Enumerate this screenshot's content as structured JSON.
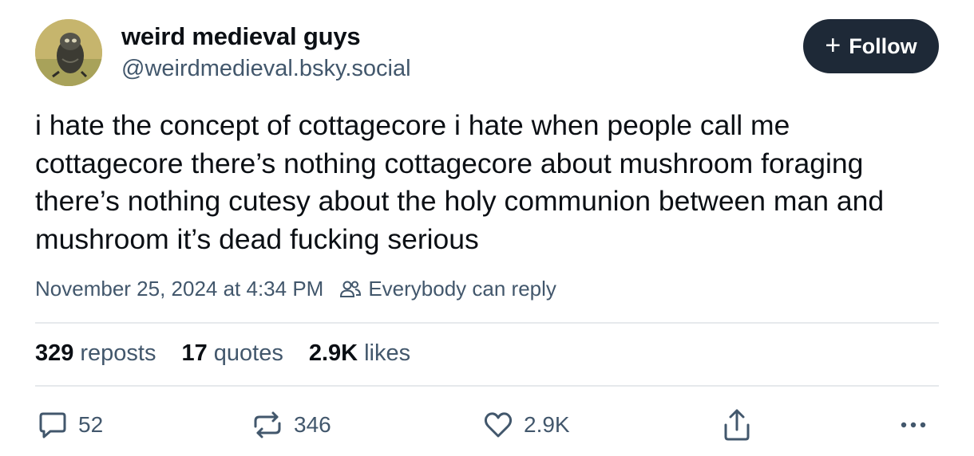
{
  "author": {
    "display_name": "weird medieval guys",
    "handle": "@weirdmedieval.bsky.social"
  },
  "follow_button": {
    "label": "Follow"
  },
  "post": {
    "text": "i hate the concept of cottagecore i hate when people call me cottagecore there’s nothing cottagecore about mushroom foraging there’s nothing cutesy about the holy communion between man and mushroom it’s dead fucking serious",
    "timestamp": "November 25, 2024 at 4:34 PM",
    "reply_setting": "Everybody can reply"
  },
  "stats": {
    "reposts_count": "329",
    "reposts_label": "reposts",
    "quotes_count": "17",
    "quotes_label": "quotes",
    "likes_count": "2.9K",
    "likes_label": "likes"
  },
  "actions": {
    "reply_count": "52",
    "repost_count": "346",
    "like_count": "2.9K"
  },
  "icons": {
    "reply": "speech-bubble-icon",
    "repost": "repost-arrows-icon",
    "like": "heart-icon",
    "share": "share-icon",
    "more": "ellipsis-icon",
    "audience": "people-icon"
  },
  "colors": {
    "text_primary": "#0b0f14",
    "text_secondary": "#42576c",
    "follow_bg": "#1e2937",
    "divider": "#e6e9ec"
  }
}
